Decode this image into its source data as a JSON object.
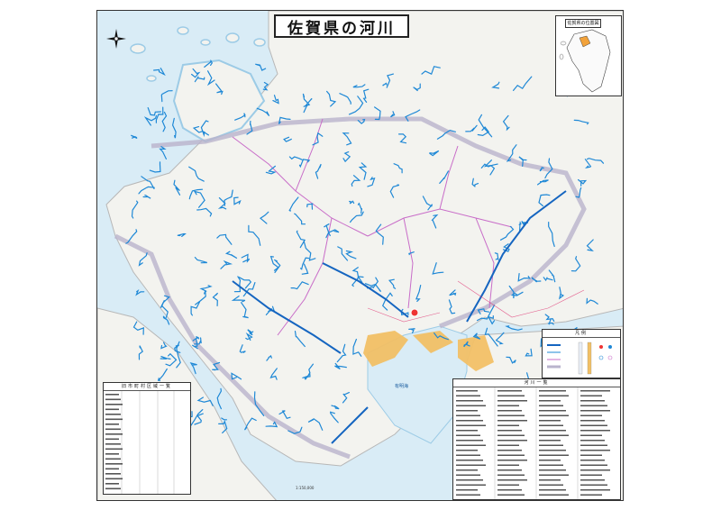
{
  "map": {
    "title": "佐賀県の河川",
    "inset_label": "佐賀県の位置図",
    "legend_heading": "凡例",
    "left_table_heading": "旧市町村区域一覧",
    "right_table_heading": "河川一覧",
    "bay_label": "有明海",
    "scale_text": "1:150,000",
    "colors": {
      "sea": "#d9ecf6",
      "land": "#f3f3ef",
      "river": "#1e88d6",
      "boundary": "#c86cc8",
      "tidal_flat": "#f2c066",
      "prefecture_line": "#b9b3cc"
    }
  }
}
